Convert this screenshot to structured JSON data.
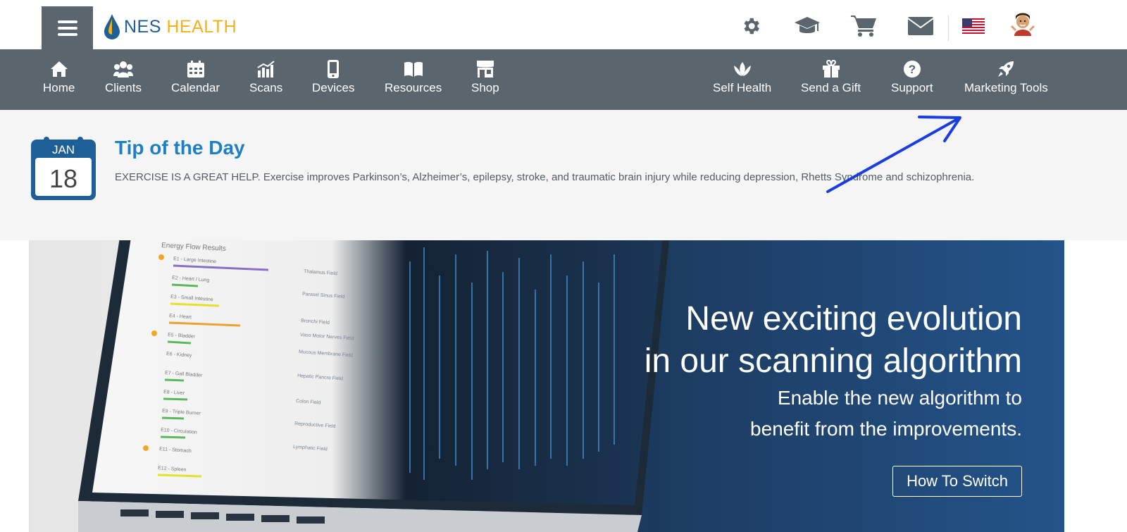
{
  "logo": {
    "name_part1": "NES",
    "name_part2": "HEALTH"
  },
  "nav": {
    "left": [
      {
        "label": "Home",
        "icon": "home-icon"
      },
      {
        "label": "Clients",
        "icon": "clients-icon"
      },
      {
        "label": "Calendar",
        "icon": "calendar-icon"
      },
      {
        "label": "Scans",
        "icon": "scans-icon"
      },
      {
        "label": "Devices",
        "icon": "device-icon"
      },
      {
        "label": "Resources",
        "icon": "book-icon"
      },
      {
        "label": "Shop",
        "icon": "shop-icon"
      }
    ],
    "right": [
      {
        "label": "Self Health",
        "icon": "lotus-icon"
      },
      {
        "label": "Send a Gift",
        "icon": "gift-icon"
      },
      {
        "label": "Support",
        "icon": "help-icon"
      },
      {
        "label": "Marketing Tools",
        "icon": "rocket-icon"
      }
    ]
  },
  "top_icons": [
    "gear-icon",
    "graduation-cap-icon",
    "cart-icon",
    "mail-icon",
    "us-flag-icon",
    "avatar"
  ],
  "tip": {
    "month": "JAN",
    "day": "18",
    "title": "Tip of the Day",
    "body": "EXERCISE IS A GREAT HELP. Exercise improves Parkinson’s, Alzheimer’s, epilepsy, stroke, and traumatic brain injury while reducing depression, Rhetts Syndrome and schizophrenia."
  },
  "hero": {
    "headline_line1": "New exciting evolution",
    "headline_line2": "in our scanning algorithm",
    "sub_line1": "Enable the new algorithm to",
    "sub_line2": "benefit from the improvements.",
    "button": "How To Switch",
    "screen_title": "Energy Flow Results",
    "screen_rows": [
      "E1 - Large Intestine",
      "E2 - Heart / Lung",
      "E3 - Small Intestine",
      "E4 - Heart",
      "E5 - Bladder",
      "E6 - Kidney",
      "E7 - Gall Bladder",
      "E8 - Liver",
      "E9 - Triple Burner",
      "E10 - Circulation",
      "E11 - Stomach",
      "E12 - Spleen"
    ],
    "screen_fields": [
      "Thalamus Field",
      "Parasel Sinus Field",
      "Bronchi Field",
      "Vaso Motor Nerves Field",
      "Mucous Membrane Field",
      "Hepatic Pancre Field",
      "Colon Field",
      "Reproductive Field",
      "Lymphatic Field"
    ]
  },
  "colors": {
    "nav_bg": "#5b656d",
    "tip_title": "#1e7fc2",
    "brand_blue": "#1f5f97",
    "brand_gold": "#f2b21c",
    "hero_blue": "#24548a",
    "annotation_arrow": "#1a3de0"
  }
}
